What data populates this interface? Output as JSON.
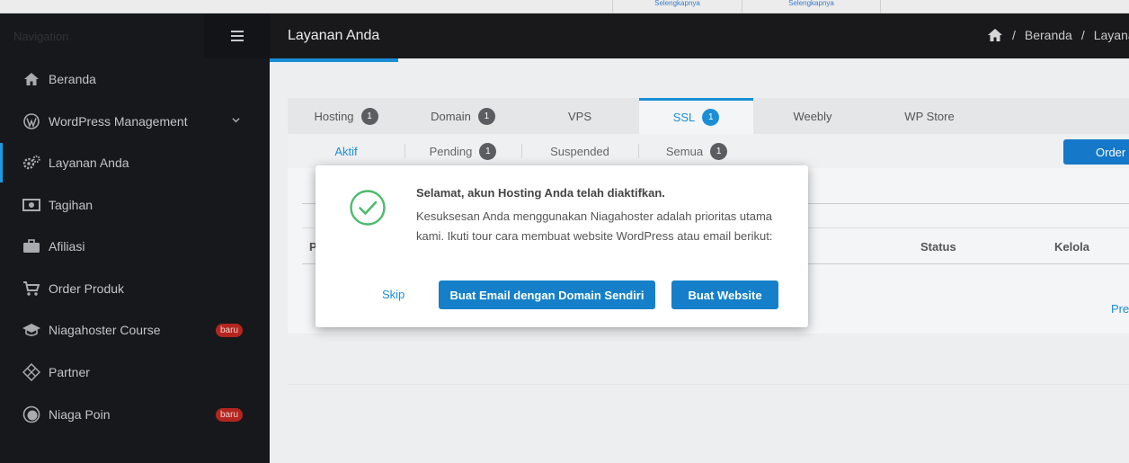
{
  "topstrip": {
    "link1": "Selengkapnya",
    "link2": "Selengkapnya"
  },
  "sidebar": {
    "nav_label": "Navigation",
    "items": [
      {
        "label": "Beranda",
        "icon": "home-icon"
      },
      {
        "label": "WordPress Management",
        "icon": "wordpress-icon"
      },
      {
        "label": "Layanan Anda",
        "icon": "gears-icon"
      },
      {
        "label": "Tagihan",
        "icon": "money-icon"
      },
      {
        "label": "Afiliasi",
        "icon": "briefcase-icon"
      },
      {
        "label": "Order Produk",
        "icon": "cart-icon"
      },
      {
        "label": "Niagahoster Course",
        "icon": "graduation-cap-icon",
        "badge": "baru"
      },
      {
        "label": "Partner",
        "icon": "partner-icon"
      },
      {
        "label": "Niaga Poin",
        "icon": "coin-icon",
        "badge": "baru"
      }
    ]
  },
  "header": {
    "title": "Layanan Anda",
    "breadcrumb_home": "Beranda",
    "breadcrumb_current": "Layanan Anda"
  },
  "tabs": [
    {
      "label": "Hosting",
      "count": "1"
    },
    {
      "label": "Domain",
      "count": "1"
    },
    {
      "label": "VPS"
    },
    {
      "label": "SSL",
      "count": "1"
    },
    {
      "label": "Weebly"
    },
    {
      "label": "WP Store"
    }
  ],
  "subtabs": [
    {
      "label": "Aktif"
    },
    {
      "label": "Pending",
      "count": "1"
    },
    {
      "label": "Suspended"
    },
    {
      "label": "Semua",
      "count": "1"
    }
  ],
  "order_button": "Order SSL",
  "table": {
    "col_first": "P",
    "col_status": "Status",
    "col_kelola": "Kelola"
  },
  "pagination": {
    "prev": "Previous"
  },
  "modal": {
    "title": "Selamat, akun Hosting Anda telah diaktifkan.",
    "body": "Kesuksesan Anda menggunakan Niagahoster adalah prioritas utama kami. Ikuti tour cara membuat website WordPress atau email berikut:",
    "skip": "Skip",
    "btn_email": "Buat Email dengan Domain Sendiri",
    "btn_website": "Buat Website"
  },
  "colors": {
    "accent": "#1a8fd6",
    "sidebar_bg": "#17181c",
    "header_bg": "#19191b",
    "badge_red": "#b3261e",
    "success": "#4cbb6c"
  }
}
